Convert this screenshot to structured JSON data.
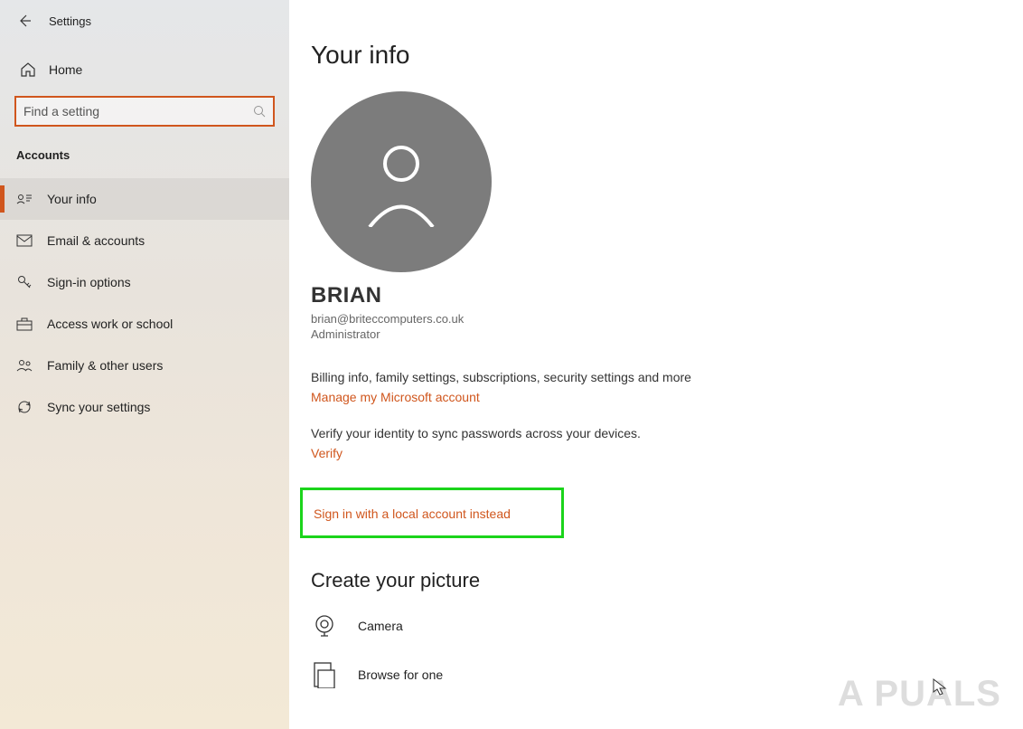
{
  "header": {
    "title": "Settings"
  },
  "home": {
    "label": "Home"
  },
  "search": {
    "placeholder": "Find a setting"
  },
  "sidebar": {
    "section_label": "Accounts",
    "items": [
      {
        "label": "Your info"
      },
      {
        "label": "Email & accounts"
      },
      {
        "label": "Sign-in options"
      },
      {
        "label": "Access work or school"
      },
      {
        "label": "Family & other users"
      },
      {
        "label": "Sync your settings"
      }
    ]
  },
  "main": {
    "heading": "Your info",
    "user": {
      "name": "BRIAN",
      "email": "brian@briteccomputers.co.uk",
      "role": "Administrator"
    },
    "billing_text": "Billing info, family settings, subscriptions, security settings and more",
    "manage_link": "Manage my Microsoft account",
    "verify_text": "Verify your identity to sync passwords across your devices.",
    "verify_link": "Verify",
    "local_account_link": "Sign in with a local account instead",
    "picture": {
      "heading": "Create your picture",
      "camera_label": "Camera",
      "browse_label": "Browse for one"
    }
  },
  "watermark": "A  PUALS"
}
